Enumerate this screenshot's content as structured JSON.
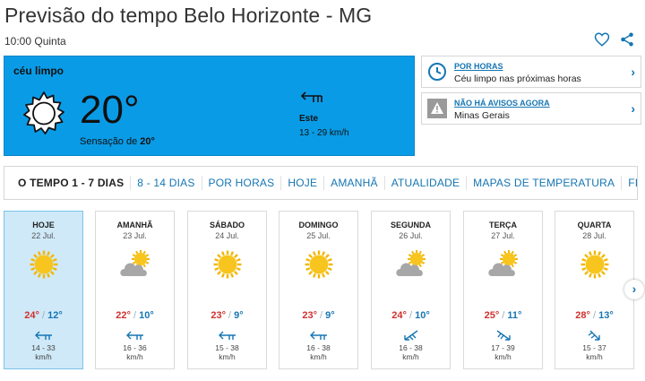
{
  "header": {
    "title": "Previsão do tempo Belo Horizonte - MG",
    "subtitle": "10:00 Quinta",
    "favorite_icon": "heart-icon",
    "share_icon": "share-icon"
  },
  "now": {
    "condition": "céu limpo",
    "icon": "sun-icon",
    "temperature": "20°",
    "feels_label": "Sensação de ",
    "feels_value": "20°",
    "wind_direction": "Este",
    "wind_speed": "13 - 29 km/h"
  },
  "cards": [
    {
      "title": "POR HORAS",
      "text": "Céu limpo nas próximas horas",
      "icon": "clock-icon"
    },
    {
      "title": "NÃO HÁ AVISOS AGORA",
      "text": "Minas Gerais",
      "icon": "warning-icon"
    }
  ],
  "tabs": [
    "O TEMPO 1 - 7 DIAS",
    "8 - 14 DIAS",
    "POR HORAS",
    "HOJE",
    "AMANHÃ",
    "ATUALIDADE",
    "MAPAS DE TEMPERATURA",
    "FIM-DE"
  ],
  "days": [
    {
      "name": "HOJE",
      "date": "22 Jul.",
      "icon": "sun-icon",
      "max": "24°",
      "min": "12°",
      "wind": "14 - 33",
      "unit": "km/h"
    },
    {
      "name": "AMANHÃ",
      "date": "23 Jul.",
      "icon": "partly-cloudy-icon",
      "max": "22°",
      "min": "10°",
      "wind": "16 - 36",
      "unit": "km/h"
    },
    {
      "name": "SÁBADO",
      "date": "24 Jul.",
      "icon": "sun-icon",
      "max": "23°",
      "min": "9°",
      "wind": "15 - 38",
      "unit": "km/h"
    },
    {
      "name": "DOMINGO",
      "date": "25 Jul.",
      "icon": "sun-icon",
      "max": "23°",
      "min": "9°",
      "wind": "16 - 38",
      "unit": "km/h"
    },
    {
      "name": "SEGUNDA",
      "date": "26 Jul.",
      "icon": "partly-cloudy-icon",
      "max": "24°",
      "min": "10°",
      "wind": "16 - 38",
      "unit": "km/h"
    },
    {
      "name": "TERÇA",
      "date": "27 Jul.",
      "icon": "partly-cloudy-icon",
      "max": "25°",
      "min": "11°",
      "wind": "17 - 39",
      "unit": "km/h"
    },
    {
      "name": "QUARTA",
      "date": "28 Jul.",
      "icon": "sun-icon",
      "max": "28°",
      "min": "13°",
      "wind": "15 - 37",
      "unit": "km/h"
    }
  ],
  "colors": {
    "accent": "#0a9be6",
    "link": "#1576b3",
    "max": "#d0312d",
    "selected_day": "#cfe9f8"
  }
}
